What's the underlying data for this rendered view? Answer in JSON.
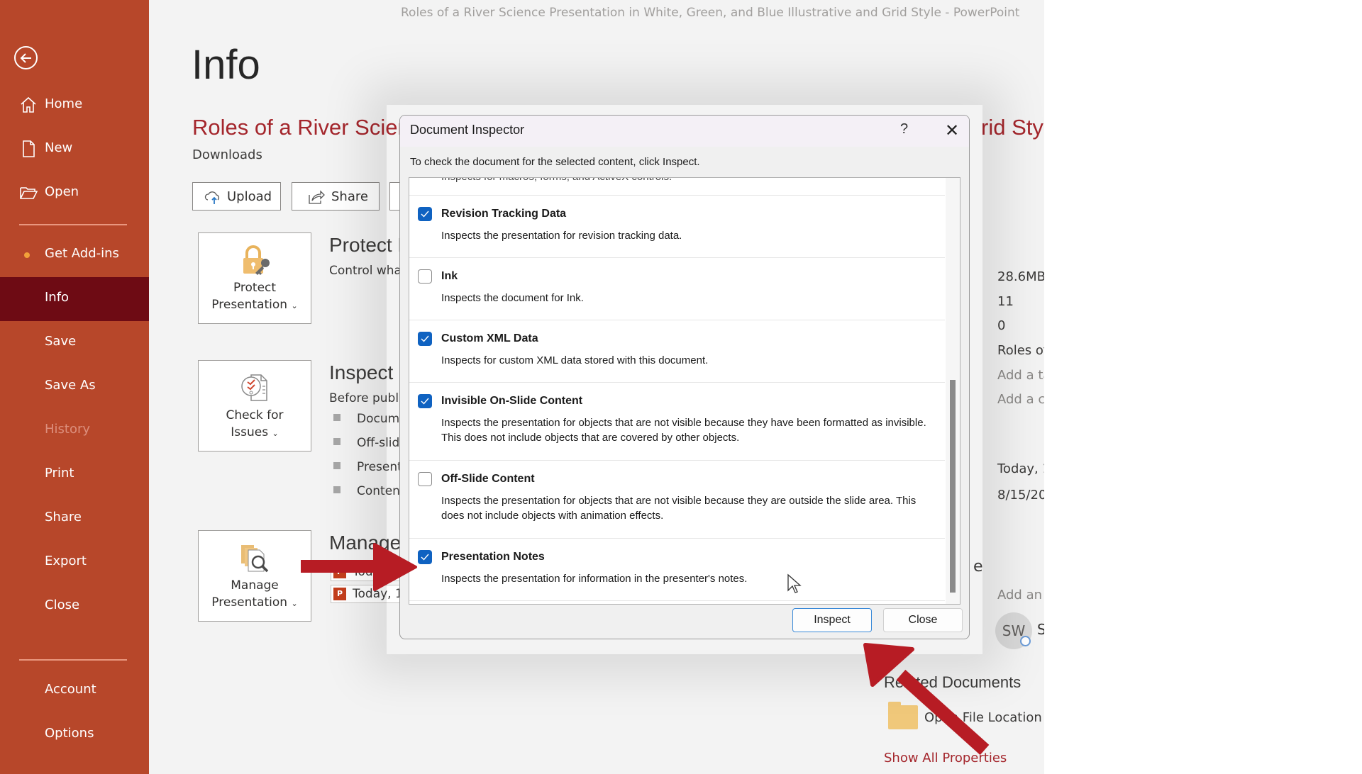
{
  "window": {
    "title": "Roles of a River Science Presentation in White, Green, and Blue Illustrative and Grid Style  -  PowerPoint"
  },
  "sidebar": {
    "back_icon": "back-arrow-icon",
    "items": [
      {
        "label": "Home",
        "icon": "home-icon"
      },
      {
        "label": "New",
        "icon": "new-document-icon"
      },
      {
        "label": "Open",
        "icon": "open-folder-icon"
      },
      {
        "label": "Get Add-ins",
        "icon": "notification-dot-icon"
      },
      {
        "label": "Info",
        "selected": true
      },
      {
        "label": "Save"
      },
      {
        "label": "Save As"
      },
      {
        "label": "History",
        "disabled": true
      },
      {
        "label": "Print"
      },
      {
        "label": "Share"
      },
      {
        "label": "Export"
      },
      {
        "label": "Close"
      },
      {
        "label": "Account"
      },
      {
        "label": "Options"
      }
    ]
  },
  "main": {
    "heading": "Info",
    "doc_title": "Roles of a River Scien",
    "doc_title_tail": "rid Sty",
    "location": "Downloads",
    "actions": {
      "upload": "Upload",
      "share": "Share"
    },
    "protect": {
      "button_l1": "Protect",
      "button_l2": "Presentation",
      "heading": "Protect P",
      "desc": "Control what"
    },
    "inspect": {
      "button_l1": "Check for",
      "button_l2": "Issues",
      "heading": "Inspect P",
      "desc": "Before publis",
      "bullets": [
        "Docume",
        "Off-slid",
        "Presenta",
        "Content"
      ]
    },
    "manage": {
      "button_l1": "Manage",
      "button_l2": "Presentation",
      "heading": "Manage",
      "versions": [
        "Toda",
        "Today, 1"
      ]
    }
  },
  "properties": {
    "size": "28.6MB",
    "slides": "11",
    "hidden_slides": "0",
    "title": "Roles of",
    "tags": "Add a ta",
    "categories": "Add a ca",
    "last_modified": "Today, 1",
    "created": "8/15/20",
    "partial_label": "e",
    "add_author": "Add an a",
    "author_initials": "SW",
    "author_name": "S",
    "related_heading": "Related Documents",
    "open_file_location": "Open File Location",
    "show_all": "Show All Properties"
  },
  "dialog": {
    "title": "Document Inspector",
    "help": "?",
    "close_glyph": "✕",
    "instruction": "To check the document for the selected content, click Inspect.",
    "partial_top_text": "Inspects for macros, forms, and ActiveX controls.",
    "items": [
      {
        "name": "Revision Tracking Data",
        "checked": true,
        "desc": "Inspects the presentation for revision tracking data."
      },
      {
        "name": "Ink",
        "checked": false,
        "desc": "Inspects the document for Ink."
      },
      {
        "name": "Custom XML Data",
        "checked": true,
        "desc": "Inspects for custom XML data stored with this document."
      },
      {
        "name": "Invisible On-Slide Content",
        "checked": true,
        "desc": "Inspects the presentation for objects that are not visible because they have been formatted as invisible. This does not include objects that are covered by other objects."
      },
      {
        "name": "Off-Slide Content",
        "checked": false,
        "desc": "Inspects the presentation for objects that are not visible because they are outside the slide area. This does not include objects with animation effects."
      },
      {
        "name": "Presentation Notes",
        "checked": true,
        "desc": "Inspects the presentation for information in the presenter's notes."
      }
    ],
    "buttons": {
      "inspect": "Inspect",
      "close": "Close"
    }
  },
  "annotations": {
    "arrow_color": "#b71c24"
  },
  "colors": {
    "sidebar": "#b7472a",
    "sidebar_selected": "#6e0b14",
    "accent_red": "#a4262c",
    "checkbox_blue": "#0f62c1"
  }
}
